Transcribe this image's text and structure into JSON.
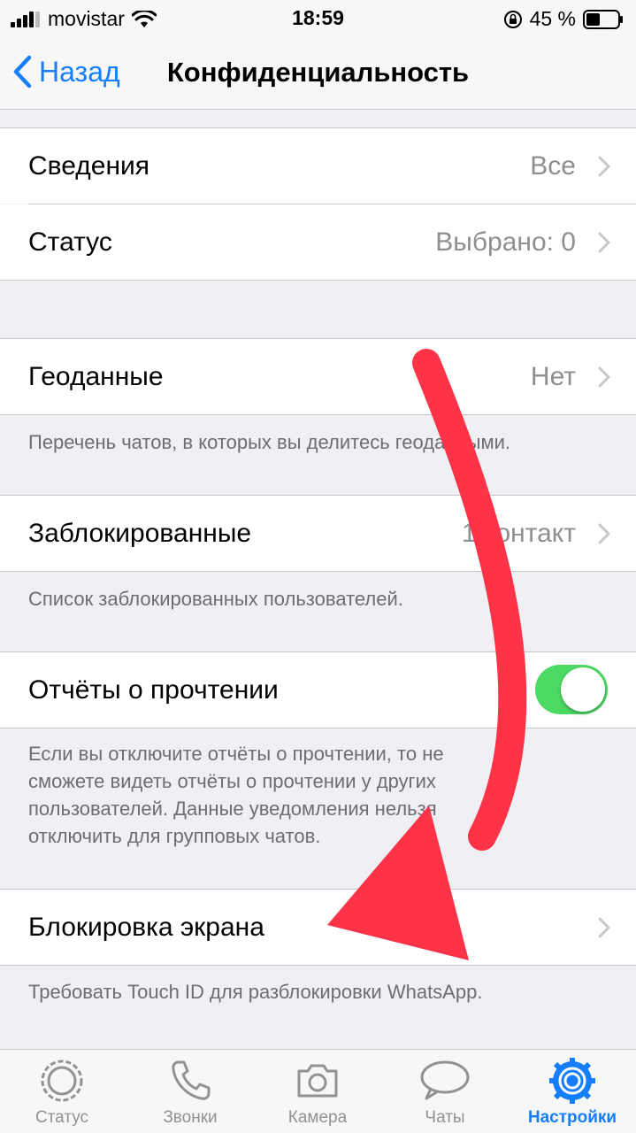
{
  "status_bar": {
    "carrier": "movistar",
    "time": "18:59",
    "battery": "45 %",
    "battery_level": 0.45
  },
  "nav": {
    "back_label": "Назад",
    "title": "Конфиденциальность"
  },
  "rows": {
    "info": {
      "label": "Сведения",
      "value": "Все"
    },
    "status": {
      "label": "Статус",
      "value": "Выбрано: 0"
    },
    "location": {
      "label": "Геоданные",
      "value": "Нет",
      "footer": "Перечень чатов, в которых вы делитесь геоданными."
    },
    "blocked": {
      "label": "Заблокированные",
      "value": "1 контакт",
      "footer": "Список заблокированных пользователей."
    },
    "read_receipts": {
      "label": "Отчёты о прочтении",
      "on": true,
      "footer_lines": [
        "Если вы отключите отчёты о прочтении, то не",
        "сможете видеть отчёты о прочтении у других",
        "пользователей. Данные уведомления нельзя",
        "отключить для групповых чатов."
      ]
    },
    "screen_lock": {
      "label": "Блокировка экрана",
      "footer": "Требовать Touch ID для разблокировки WhatsApp."
    }
  },
  "tabs": [
    {
      "label": "Статус",
      "icon": "status-icon"
    },
    {
      "label": "Звонки",
      "icon": "phone-icon"
    },
    {
      "label": "Камера",
      "icon": "camera-icon"
    },
    {
      "label": "Чаты",
      "icon": "chats-icon"
    },
    {
      "label": "Настройки",
      "icon": "settings-icon",
      "active": true
    }
  ],
  "colors": {
    "accent": "#147efb",
    "toggle_on": "#4cd964",
    "annotation_arrow": "#ff3347",
    "background": "#efeff4"
  }
}
